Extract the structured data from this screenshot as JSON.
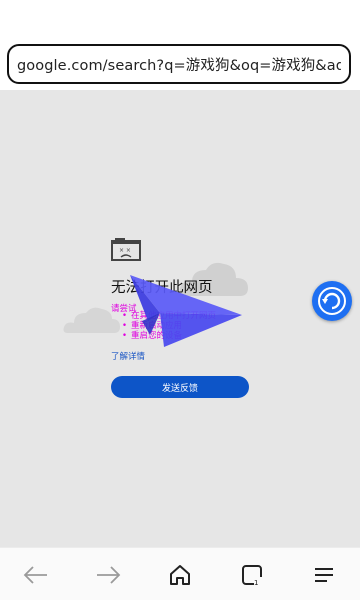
{
  "browser": {
    "url": "google.com/search?q=游戏狗&oq=游戏狗&aqs="
  },
  "error": {
    "icon": "sad-page-icon",
    "title": "无法打开此网页",
    "suggest_heading": "请尝试",
    "suggestions": [
      "在其他应用中打开网页",
      "重新启动应用",
      "重启您的设备"
    ],
    "learn_more": "了解详情",
    "feedback_button": "发送反馈"
  },
  "overlays": {
    "plane_icon": "paper-plane-icon",
    "refresh_icon": "refresh-icon",
    "plane_color": "#5252f5",
    "fab_color": "#1e6ff2"
  },
  "bottom_nav": [
    {
      "name": "back",
      "icon": "arrow-left-icon"
    },
    {
      "name": "forward",
      "icon": "arrow-right-icon"
    },
    {
      "name": "home",
      "icon": "home-icon"
    },
    {
      "name": "tabs",
      "icon": "tabs-icon",
      "count": "1"
    },
    {
      "name": "menu",
      "icon": "menu-icon"
    }
  ]
}
